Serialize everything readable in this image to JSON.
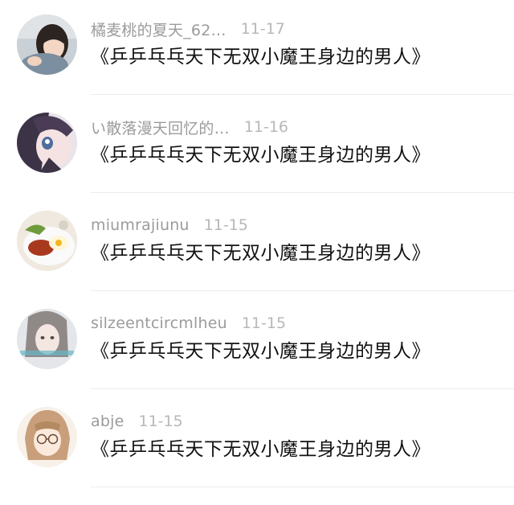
{
  "comments": [
    {
      "username": "橘麦桃的夏天_62…",
      "time": "11-17",
      "content": "《乒乒乓乓天下无双小魔王身边的男人》",
      "avatar_icon": "girl-photo-avatar"
    },
    {
      "username": "い散落漫天回忆的…",
      "time": "11-16",
      "content": "《乒乒乓乓天下无双小魔王身边的男人》",
      "avatar_icon": "anime-girl-avatar"
    },
    {
      "username": "miumrajiunu",
      "time": "11-15",
      "content": "《乒乒乓乓天下无双小魔王身边的男人》",
      "avatar_icon": "food-plate-avatar"
    },
    {
      "username": "silzeentcircmlheu",
      "time": "11-15",
      "content": "《乒乒乓乓天下无双小魔王身边的男人》",
      "avatar_icon": "girl-portrait-avatar"
    },
    {
      "username": "abje",
      "time": "11-15",
      "content": "《乒乒乓乓天下无双小魔王身边的男人》",
      "avatar_icon": "cartoon-girl-glasses-avatar"
    }
  ]
}
